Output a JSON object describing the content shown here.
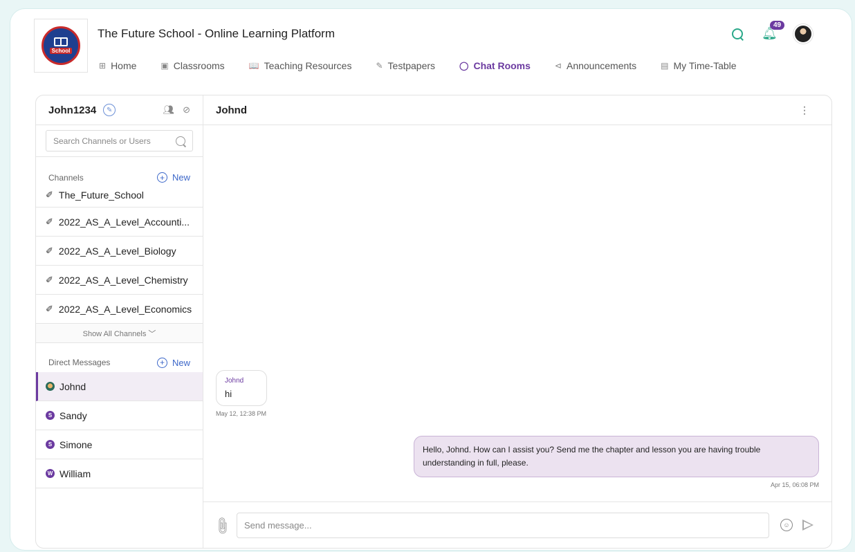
{
  "app": {
    "title": "The Future School - Online Learning Platform",
    "logo_text": "School"
  },
  "nav": [
    {
      "label": "Home",
      "icon": "grid-icon",
      "glyph": "⊞"
    },
    {
      "label": "Classrooms",
      "icon": "classroom-icon",
      "glyph": "▣"
    },
    {
      "label": "Teaching Resources",
      "icon": "book-icon",
      "glyph": "📖"
    },
    {
      "label": "Testpapers",
      "icon": "testpaper-icon",
      "glyph": "✎"
    },
    {
      "label": "Chat Rooms",
      "icon": "chat-icon",
      "glyph": "◯",
      "active": true
    },
    {
      "label": "Announcements",
      "icon": "megaphone-icon",
      "glyph": "⊲"
    },
    {
      "label": "My Time-Table",
      "icon": "calendar-icon",
      "glyph": "▤"
    }
  ],
  "header": {
    "notification_count": "49"
  },
  "sidebar": {
    "username": "John1234",
    "search_placeholder": "Search Channels or Users",
    "channels_label": "Channels",
    "new_label": "New",
    "channels": [
      "The_Future_School",
      "2022_AS_A_Level_Accounti...",
      "2022_AS_A_Level_Biology",
      "2022_AS_A_Level_Chemistry",
      "2022_AS_A_Level_Economics"
    ],
    "show_all_label": "Show All Channels ﹀",
    "dm_label": "Direct Messages",
    "dms": [
      {
        "name": "Johnd",
        "initial": "",
        "active": true
      },
      {
        "name": "Sandy",
        "initial": "S"
      },
      {
        "name": "Simone",
        "initial": "S"
      },
      {
        "name": "William",
        "initial": "W"
      }
    ]
  },
  "chat": {
    "title": "Johnd",
    "messages": [
      {
        "sender": "Johnd",
        "text": "hi",
        "time": "May 12, 12:38 PM"
      },
      {
        "text": "Hello, Johnd. How can I assist you? Send me the chapter and lesson you are having trouble understanding in full, please.",
        "time": "Apr 15, 06:08 PM"
      }
    ],
    "input_placeholder": "Send message..."
  },
  "colors": {
    "accent": "#6b3aa0",
    "teal": "#2aa889",
    "link": "#3c67c9"
  }
}
